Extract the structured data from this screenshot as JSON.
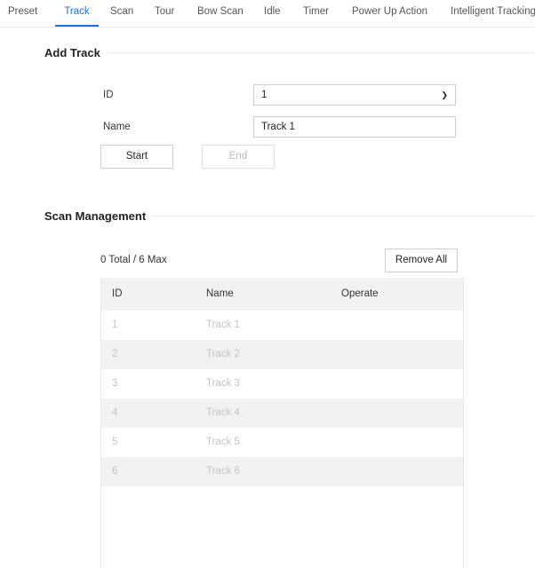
{
  "tabs": [
    {
      "label": "Preset",
      "active": false
    },
    {
      "label": "Track",
      "active": true
    },
    {
      "label": "Scan",
      "active": false
    },
    {
      "label": "Tour",
      "active": false
    },
    {
      "label": "Bow Scan",
      "active": false
    },
    {
      "label": "Idle",
      "active": false
    },
    {
      "label": "Timer",
      "active": false
    },
    {
      "label": "Power Up Action",
      "active": false
    },
    {
      "label": "Intelligent Tracking",
      "active": false
    }
  ],
  "add_track": {
    "title": "Add Track",
    "id_label": "ID",
    "id_value": "1",
    "name_label": "Name",
    "name_value": "Track 1",
    "start_label": "Start",
    "end_label": "End"
  },
  "scan_management": {
    "title": "Scan Management",
    "count_text": "0 Total / 6 Max",
    "remove_all_label": "Remove All",
    "columns": [
      "ID",
      "Name",
      "Operate"
    ],
    "rows": [
      {
        "id": "1",
        "name": "Track 1",
        "operate": ""
      },
      {
        "id": "2",
        "name": "Track 2",
        "operate": ""
      },
      {
        "id": "3",
        "name": "Track 3",
        "operate": ""
      },
      {
        "id": "4",
        "name": "Track 4",
        "operate": ""
      },
      {
        "id": "5",
        "name": "Track 5",
        "operate": ""
      },
      {
        "id": "6",
        "name": "Track 6",
        "operate": ""
      }
    ]
  },
  "colors": {
    "accent": "#1e6fd9",
    "row_alt": "#f2f2f2",
    "disabled_text": "#c4c4c4"
  },
  "icons": {
    "select_arrow": "chevron-down-icon"
  }
}
